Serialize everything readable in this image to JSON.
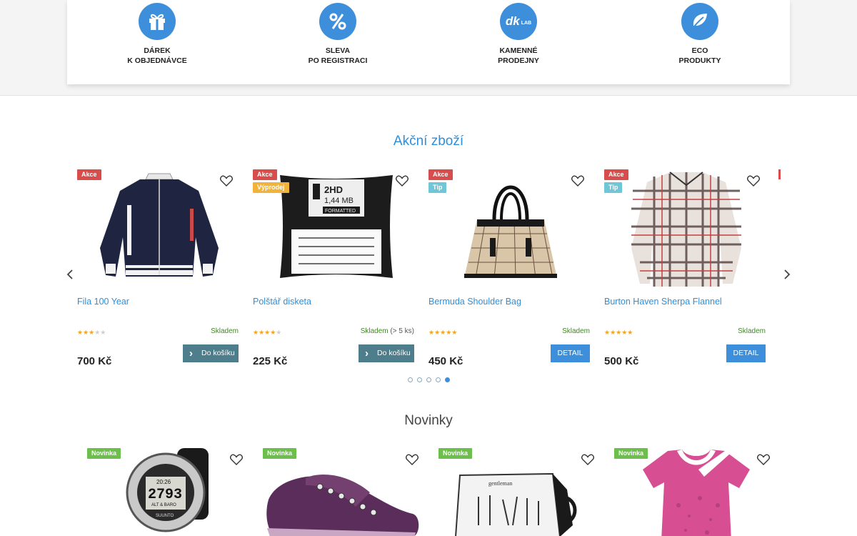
{
  "features": [
    {
      "icon": "gift-icon",
      "line1": "DÁREK",
      "line2": "K OBJEDNÁVCE"
    },
    {
      "icon": "percent-icon",
      "line1": "SLEVA",
      "line2": "PO REGISTRACI"
    },
    {
      "icon": "dklab-logo-icon",
      "line1": "KAMENNÉ",
      "line2": "PRODEJNY",
      "logo_main": "dk",
      "logo_sub": "LAB"
    },
    {
      "icon": "leaf-icon",
      "line1": "ECO",
      "line2": "PRODUKTY"
    }
  ],
  "sale_section": {
    "title": "Akční zboží",
    "products": [
      {
        "name": "Fila 100 Year",
        "badges": [
          "Akce"
        ],
        "rating": 3,
        "stock": "Skladem",
        "stock_extra": "",
        "price": "700 Kč",
        "button": "Do košíku",
        "button_type": "cart"
      },
      {
        "name": "Polštář disketa",
        "badges": [
          "Akce",
          "Výprodej"
        ],
        "rating": 4,
        "stock": "Skladem",
        "stock_extra": "(> 5 ks)",
        "price": "225 Kč",
        "button": "Do košíku",
        "button_type": "cart",
        "image_text": {
          "line1": "2HD",
          "line2": "1,44 MB",
          "line3": "FORMATTED"
        }
      },
      {
        "name": "Bermuda Shoulder Bag",
        "badges": [
          "Akce",
          "Tip"
        ],
        "rating": 5,
        "stock": "Skladem",
        "stock_extra": "",
        "price": "450 Kč",
        "button": "DETAIL",
        "button_type": "detail"
      },
      {
        "name": "Burton Haven Sherpa Flannel",
        "badges": [
          "Akce",
          "Tip"
        ],
        "rating": 5,
        "stock": "Skladem",
        "stock_extra": "",
        "price": "500 Kč",
        "button": "DETAIL",
        "button_type": "detail"
      }
    ],
    "carousel": {
      "pages": 5,
      "active": 5
    }
  },
  "new_section": {
    "title": "Novinky",
    "products": [
      {
        "badge": "Novinka",
        "image_text": {
          "line1": "20:26",
          "line2": "2793",
          "line3": "ALT & BARO",
          "line4": "SUUNTO"
        }
      },
      {
        "badge": "Novinka"
      },
      {
        "badge": "Novinka",
        "image_text": {
          "line1": "gentleman"
        }
      },
      {
        "badge": "Novinka"
      }
    ]
  },
  "colors": {
    "accent": "#3d8fdb",
    "sale": "#d94c4c",
    "clearance": "#f2b33a",
    "tip": "#6fc6d6",
    "new": "#6cbf4a",
    "cart_button": "#4e7d8c",
    "in_stock": "#3d8a1f"
  }
}
